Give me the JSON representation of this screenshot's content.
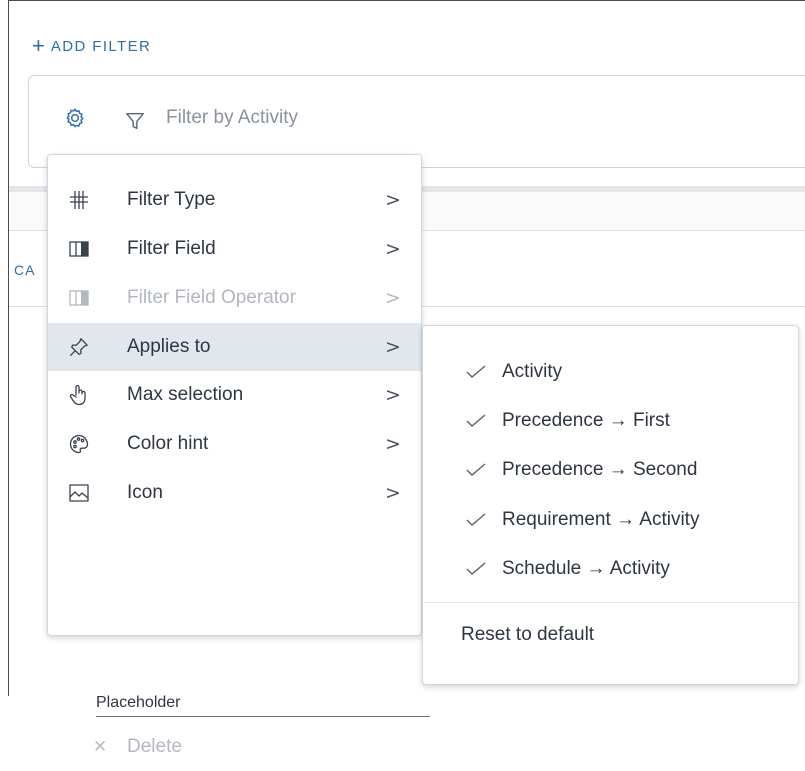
{
  "toolbar": {
    "add_filter_label": "ADD FILTER"
  },
  "filter": {
    "placeholder": "Filter by Activity"
  },
  "partial_heading": "CA",
  "context_menu": {
    "items": [
      {
        "label": "Filter Type",
        "icon": "grid-icon",
        "chevron": ">",
        "disabled": false
      },
      {
        "label": "Filter Field",
        "icon": "column-icon",
        "chevron": ">",
        "disabled": false
      },
      {
        "label": "Filter Field Operator",
        "icon": "column-icon",
        "chevron": ">",
        "disabled": true
      },
      {
        "label": "Applies to",
        "icon": "pin-icon",
        "chevron": ">",
        "active": true
      },
      {
        "label": "Max selection",
        "icon": "hand-pointer-icon",
        "chevron": ">"
      },
      {
        "label": "Color hint",
        "icon": "palette-icon",
        "chevron": ">"
      },
      {
        "label": "Icon",
        "icon": "image-icon",
        "chevron": ">"
      }
    ],
    "placeholder_value": "Placeholder",
    "delete_label": "Delete",
    "delete_icon": "close-icon"
  },
  "applies_to_menu": {
    "options": [
      {
        "label": "Activity",
        "checked": true
      },
      {
        "label": "Precedence → First",
        "checked": true
      },
      {
        "label": "Precedence → Second",
        "checked": true
      },
      {
        "label": "Requirement → Activity",
        "checked": true
      },
      {
        "label": "Schedule → Activity",
        "checked": true
      }
    ],
    "reset_label": "Reset to default"
  },
  "colors": {
    "accent": "#2f6fa8",
    "active_row": "#e2e7ee",
    "text": "#2f3542",
    "disabled_text": "#b3b8bf"
  }
}
